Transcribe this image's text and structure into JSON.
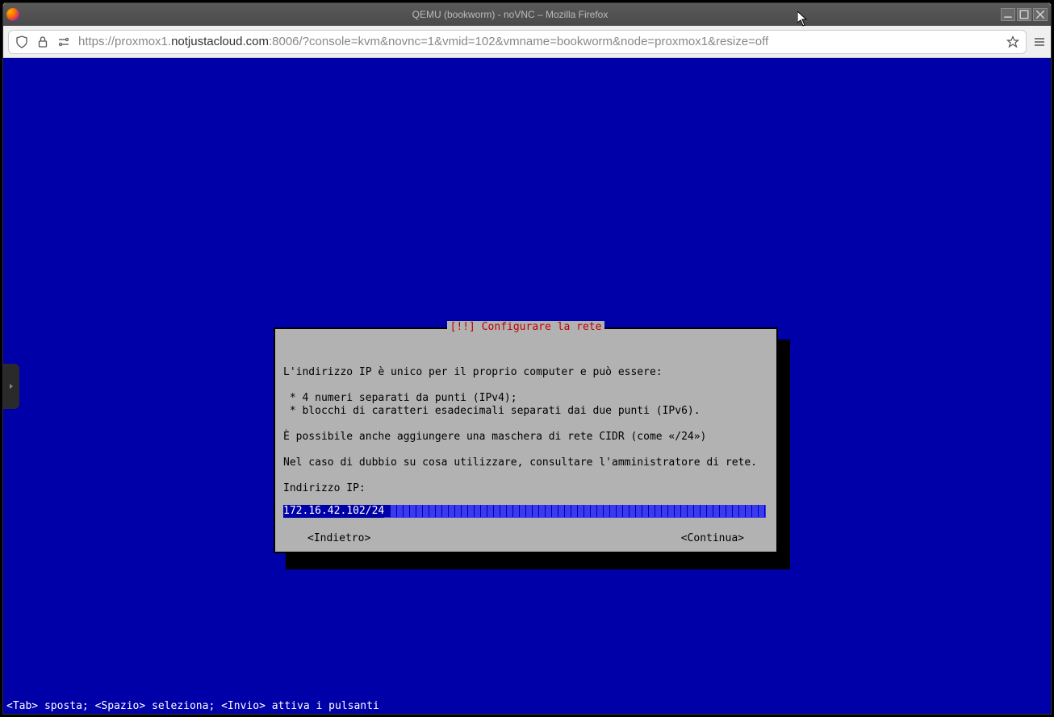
{
  "window": {
    "title": "QEMU (bookworm) - noVNC – Mozilla Firefox"
  },
  "addressbar": {
    "scheme": "https://",
    "sub": "proxmox1.",
    "host": "notjustacloud.com",
    "port_path": ":8006/?console=kvm&novnc=1&vmid=102&vmname=bookworm&node=proxmox1&resize=off"
  },
  "installer": {
    "title": "[!!] Configurare la rete",
    "line1": "L'indirizzo IP è unico per il proprio computer e può essere:",
    "bullet1": " * 4 numeri separati da punti (IPv4);",
    "bullet2": " * blocchi di caratteri esadecimali separati dai due punti (IPv6).",
    "line2": "È possibile anche aggiungere una maschera di rete CIDR (come «/24»)",
    "line3": "Nel caso di dubbio su cosa utilizzare, consultare l'amministratore di rete.",
    "field_label": "Indirizzo IP:",
    "field_value": "172.16.42.102/24",
    "back": "<Indietro>",
    "continue": "<Continua>"
  },
  "footer": {
    "hint": "<Tab> sposta; <Spazio> seleziona; <Invio> attiva i pulsanti"
  }
}
